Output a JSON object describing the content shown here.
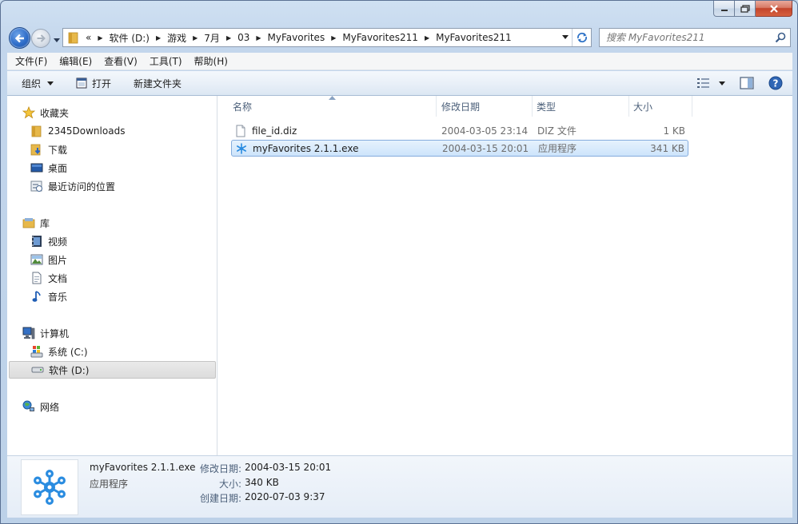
{
  "address": {
    "prefix": "«",
    "crumbs": [
      "软件 (D:)",
      "游戏",
      "7月",
      "03",
      "MyFavorites",
      "MyFavorites211",
      "MyFavorites211"
    ]
  },
  "search": {
    "placeholder": "搜索 MyFavorites211"
  },
  "menu": [
    "文件(F)",
    "编辑(E)",
    "查看(V)",
    "工具(T)",
    "帮助(H)"
  ],
  "toolbar": {
    "organize": "组织",
    "open": "打开",
    "new_folder": "新建文件夹"
  },
  "sidebar": {
    "favorites": "收藏夹",
    "fav_items": [
      "2345Downloads",
      "下载",
      "桌面",
      "最近访问的位置"
    ],
    "libraries": "库",
    "lib_items": [
      "视频",
      "图片",
      "文档",
      "音乐"
    ],
    "computer": "计算机",
    "comp_items": [
      "系统 (C:)",
      "软件 (D:)"
    ],
    "network": "网络"
  },
  "columns": {
    "name": "名称",
    "date": "修改日期",
    "type": "类型",
    "size": "大小"
  },
  "files": [
    {
      "name": "file_id.diz",
      "date": "2004-03-05 23:14",
      "type": "DIZ 文件",
      "size": "1 KB"
    },
    {
      "name": "myFavorites 2.1.1.exe",
      "date": "2004-03-15 20:01",
      "type": "应用程序",
      "size": "341 KB"
    }
  ],
  "details": {
    "name": "myFavorites 2.1.1.exe",
    "type": "应用程序",
    "modified_label": "修改日期:",
    "modified": "2004-03-15 20:01",
    "size_label": "大小:",
    "size": "340 KB",
    "created_label": "创建日期:",
    "created": "2020-07-03 9:37"
  }
}
